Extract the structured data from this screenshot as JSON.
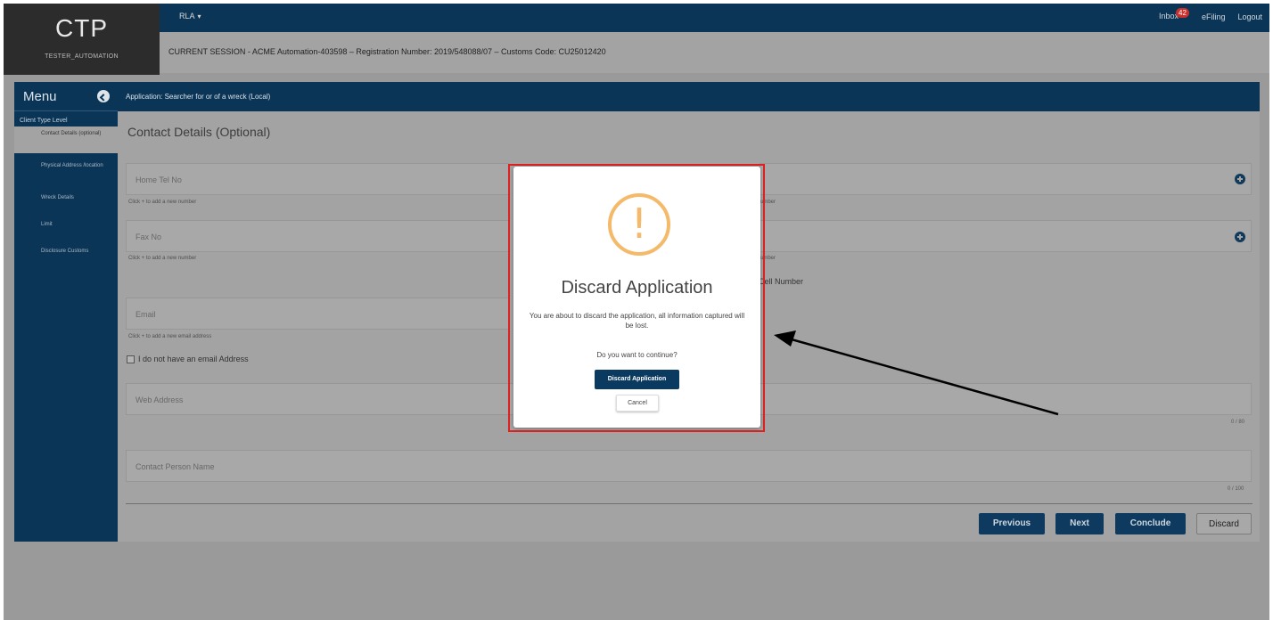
{
  "app": {
    "logo": "CTP",
    "user": "TESTER_AUTOMATION",
    "module_menu": "RLA",
    "top_links": {
      "inbox": "Inbox",
      "inbox_count": "42",
      "efiling": "eFiling",
      "logout": "Logout"
    },
    "session": "CURRENT SESSION - ACME Automation-403598 – Registration Number: 2019/548088/07 – Customs Code: CU25012420"
  },
  "sidebar": {
    "title": "Menu",
    "group": "Client Type Level",
    "items": [
      {
        "label": "Contact Details (optional)",
        "active": true
      },
      {
        "label": "Physical Address /location",
        "active": false
      },
      {
        "label": "Wreck Details",
        "active": false
      },
      {
        "label": "Limit",
        "active": false
      },
      {
        "label": "Disclosure Customs",
        "active": false
      }
    ]
  },
  "main": {
    "application_title": "Application: Searcher for or of a wreck (Local)",
    "section_title": "Contact Details (Optional)",
    "fields": {
      "home_tel": {
        "label": "Home Tel No",
        "hint": "Click + to add a new number"
      },
      "right_top_hint": "umber",
      "fax": {
        "label": "Fax No",
        "hint": "Click + to add a new number"
      },
      "right_mid_hint": "umber",
      "cell_label_fragment": "Cell Number",
      "email": {
        "label": "Email",
        "hint": "Click + to add a new email address"
      },
      "no_email_label": "I do not have an email Address",
      "web": {
        "label": "Web Address",
        "counter": "0 / 80"
      },
      "contact_person": {
        "label": "Contact Person Name",
        "counter": "0 / 100"
      }
    },
    "buttons": {
      "previous": "Previous",
      "next": "Next",
      "conclude": "Conclude",
      "discard": "Discard"
    }
  },
  "modal": {
    "icon": "warning-exclamation-icon",
    "title": "Discard Application",
    "message": "You are about to discard the application, all information captured will be lost.",
    "question": "Do you want to continue?",
    "confirm_label": "Discard Application",
    "cancel_label": "Cancel"
  },
  "colors": {
    "navy": "#0b3556",
    "overlay_gray": "#a3a3a3",
    "warning": "#f5b96a",
    "highlight": "#e02020"
  }
}
